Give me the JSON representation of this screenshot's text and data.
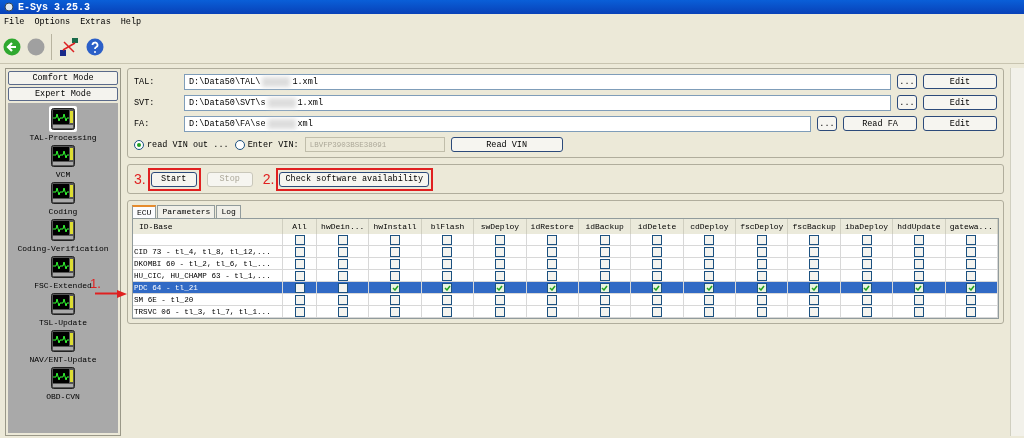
{
  "window": {
    "title": "E-Sys 3.25.3"
  },
  "menu": [
    "File",
    "Options",
    "Extras",
    "Help"
  ],
  "sidebar": {
    "modes": [
      {
        "label": "Comfort Mode"
      },
      {
        "label": "Expert Mode"
      }
    ],
    "items": [
      {
        "label": "TAL-Processing",
        "selected": true
      },
      {
        "label": "VCM",
        "selected": false
      },
      {
        "label": "Coding",
        "selected": false
      },
      {
        "label": "Coding-Verification",
        "selected": false
      },
      {
        "label": "FSC-Extended",
        "selected": false
      },
      {
        "label": "TSL-Update",
        "selected": false
      },
      {
        "label": "NAV/ENT-Update",
        "selected": false
      },
      {
        "label": "OBD-CVN",
        "selected": false
      }
    ]
  },
  "files": [
    {
      "label": "TAL:",
      "value_start": "D:\\Data50\\TAL\\",
      "value_end": "1.xml",
      "buttons": [
        "...",
        "Edit"
      ]
    },
    {
      "label": "SVT:",
      "value_start": "D:\\Data50\\SVT\\s",
      "value_end": "1.xml",
      "buttons": [
        "...",
        "Edit"
      ]
    },
    {
      "label": "FA:",
      "value_start": "D:\\Data50\\FA\\se",
      "value_end": "xml",
      "buttons": [
        "...",
        "Read FA",
        "Edit"
      ]
    }
  ],
  "vin": {
    "options": [
      {
        "label": "read VIN out ...",
        "selected": true
      },
      {
        "label": "Enter VIN:",
        "selected": false
      }
    ],
    "value": "LBVFP3903BSE38091",
    "button": "Read VIN"
  },
  "actions": [
    {
      "label": "Start",
      "disabled": false,
      "annotation": "3."
    },
    {
      "label": "Stop",
      "disabled": true
    },
    {
      "label": "Check software availability",
      "disabled": false,
      "annotation": "2."
    }
  ],
  "tabs": [
    {
      "label": "ECU",
      "selected": true
    },
    {
      "label": "Parameters",
      "selected": false
    },
    {
      "label": "Log",
      "selected": false
    }
  ],
  "table": {
    "columns": [
      "ID-Base",
      "All",
      "hwDein...",
      "hwInstall",
      "blFlash",
      "swDeploy",
      "idRestore",
      "idBackup",
      "idDelete",
      "cdDeploy",
      "fscDeploy",
      "fscBackup",
      "ibaDeploy",
      "hddUpdate",
      "gatewa..."
    ],
    "rows": [
      {
        "id": "",
        "selected": false,
        "checks": [
          false,
          false,
          false,
          false,
          false,
          false,
          false,
          false,
          false,
          false,
          false,
          false,
          false,
          false
        ]
      },
      {
        "id": "CID 73 - tl_4, tl_8, tl_12,...",
        "selected": false,
        "checks": [
          false,
          false,
          false,
          false,
          false,
          false,
          false,
          false,
          false,
          false,
          false,
          false,
          false,
          false
        ]
      },
      {
        "id": "DKOMBI 60 - tl_2, tl_6, tl_...",
        "selected": false,
        "checks": [
          false,
          false,
          false,
          false,
          false,
          false,
          false,
          false,
          false,
          false,
          false,
          false,
          false,
          false
        ]
      },
      {
        "id": "HU_CIC, HU_CHAMP 63 - tl_1,...",
        "selected": false,
        "checks": [
          false,
          false,
          false,
          false,
          false,
          false,
          false,
          false,
          false,
          false,
          false,
          false,
          false,
          false
        ]
      },
      {
        "id": "PDC 64 - tl_21",
        "selected": true,
        "checks": [
          false,
          false,
          true,
          true,
          true,
          true,
          true,
          true,
          true,
          true,
          true,
          true,
          true,
          true
        ]
      },
      {
        "id": "SM 6E - tl_20",
        "selected": false,
        "checks": [
          false,
          false,
          false,
          false,
          false,
          false,
          false,
          false,
          false,
          false,
          false,
          false,
          false,
          false
        ]
      },
      {
        "id": "TRSVC 06 - tl_3, tl_7, tl_1...",
        "selected": false,
        "checks": [
          false,
          false,
          false,
          false,
          false,
          false,
          false,
          false,
          false,
          false,
          false,
          false,
          false,
          false
        ]
      }
    ]
  },
  "arrow_annotation": "1."
}
